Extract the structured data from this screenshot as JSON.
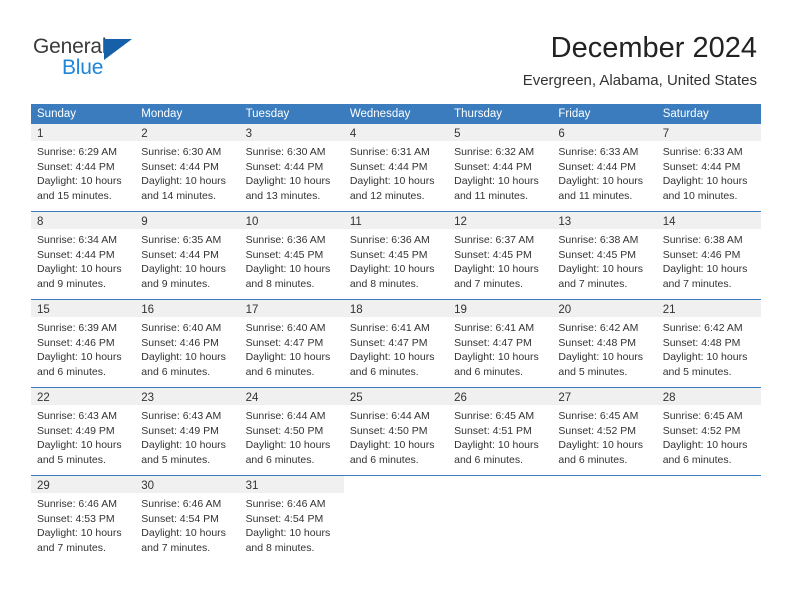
{
  "brand": {
    "name_part1": "General",
    "name_part2": "Blue",
    "accent_color": "#1f85d8",
    "triangle_color": "#1560a8",
    "logo_icon": "triangle-icon"
  },
  "header": {
    "title": "December 2024",
    "subtitle": "Evergreen, Alabama, United States"
  },
  "calendar": {
    "header_bg_color": "#3a7cbe",
    "daynum_bg_color": "#f0f0f0",
    "weekdays": [
      "Sunday",
      "Monday",
      "Tuesday",
      "Wednesday",
      "Thursday",
      "Friday",
      "Saturday"
    ],
    "weeks": [
      [
        {
          "day": "1",
          "sunrise": "Sunrise: 6:29 AM",
          "sunset": "Sunset: 4:44 PM",
          "daylight1": "Daylight: 10 hours",
          "daylight2": "and 15 minutes."
        },
        {
          "day": "2",
          "sunrise": "Sunrise: 6:30 AM",
          "sunset": "Sunset: 4:44 PM",
          "daylight1": "Daylight: 10 hours",
          "daylight2": "and 14 minutes."
        },
        {
          "day": "3",
          "sunrise": "Sunrise: 6:30 AM",
          "sunset": "Sunset: 4:44 PM",
          "daylight1": "Daylight: 10 hours",
          "daylight2": "and 13 minutes."
        },
        {
          "day": "4",
          "sunrise": "Sunrise: 6:31 AM",
          "sunset": "Sunset: 4:44 PM",
          "daylight1": "Daylight: 10 hours",
          "daylight2": "and 12 minutes."
        },
        {
          "day": "5",
          "sunrise": "Sunrise: 6:32 AM",
          "sunset": "Sunset: 4:44 PM",
          "daylight1": "Daylight: 10 hours",
          "daylight2": "and 11 minutes."
        },
        {
          "day": "6",
          "sunrise": "Sunrise: 6:33 AM",
          "sunset": "Sunset: 4:44 PM",
          "daylight1": "Daylight: 10 hours",
          "daylight2": "and 11 minutes."
        },
        {
          "day": "7",
          "sunrise": "Sunrise: 6:33 AM",
          "sunset": "Sunset: 4:44 PM",
          "daylight1": "Daylight: 10 hours",
          "daylight2": "and 10 minutes."
        }
      ],
      [
        {
          "day": "8",
          "sunrise": "Sunrise: 6:34 AM",
          "sunset": "Sunset: 4:44 PM",
          "daylight1": "Daylight: 10 hours",
          "daylight2": "and 9 minutes."
        },
        {
          "day": "9",
          "sunrise": "Sunrise: 6:35 AM",
          "sunset": "Sunset: 4:44 PM",
          "daylight1": "Daylight: 10 hours",
          "daylight2": "and 9 minutes."
        },
        {
          "day": "10",
          "sunrise": "Sunrise: 6:36 AM",
          "sunset": "Sunset: 4:45 PM",
          "daylight1": "Daylight: 10 hours",
          "daylight2": "and 8 minutes."
        },
        {
          "day": "11",
          "sunrise": "Sunrise: 6:36 AM",
          "sunset": "Sunset: 4:45 PM",
          "daylight1": "Daylight: 10 hours",
          "daylight2": "and 8 minutes."
        },
        {
          "day": "12",
          "sunrise": "Sunrise: 6:37 AM",
          "sunset": "Sunset: 4:45 PM",
          "daylight1": "Daylight: 10 hours",
          "daylight2": "and 7 minutes."
        },
        {
          "day": "13",
          "sunrise": "Sunrise: 6:38 AM",
          "sunset": "Sunset: 4:45 PM",
          "daylight1": "Daylight: 10 hours",
          "daylight2": "and 7 minutes."
        },
        {
          "day": "14",
          "sunrise": "Sunrise: 6:38 AM",
          "sunset": "Sunset: 4:46 PM",
          "daylight1": "Daylight: 10 hours",
          "daylight2": "and 7 minutes."
        }
      ],
      [
        {
          "day": "15",
          "sunrise": "Sunrise: 6:39 AM",
          "sunset": "Sunset: 4:46 PM",
          "daylight1": "Daylight: 10 hours",
          "daylight2": "and 6 minutes."
        },
        {
          "day": "16",
          "sunrise": "Sunrise: 6:40 AM",
          "sunset": "Sunset: 4:46 PM",
          "daylight1": "Daylight: 10 hours",
          "daylight2": "and 6 minutes."
        },
        {
          "day": "17",
          "sunrise": "Sunrise: 6:40 AM",
          "sunset": "Sunset: 4:47 PM",
          "daylight1": "Daylight: 10 hours",
          "daylight2": "and 6 minutes."
        },
        {
          "day": "18",
          "sunrise": "Sunrise: 6:41 AM",
          "sunset": "Sunset: 4:47 PM",
          "daylight1": "Daylight: 10 hours",
          "daylight2": "and 6 minutes."
        },
        {
          "day": "19",
          "sunrise": "Sunrise: 6:41 AM",
          "sunset": "Sunset: 4:47 PM",
          "daylight1": "Daylight: 10 hours",
          "daylight2": "and 6 minutes."
        },
        {
          "day": "20",
          "sunrise": "Sunrise: 6:42 AM",
          "sunset": "Sunset: 4:48 PM",
          "daylight1": "Daylight: 10 hours",
          "daylight2": "and 5 minutes."
        },
        {
          "day": "21",
          "sunrise": "Sunrise: 6:42 AM",
          "sunset": "Sunset: 4:48 PM",
          "daylight1": "Daylight: 10 hours",
          "daylight2": "and 5 minutes."
        }
      ],
      [
        {
          "day": "22",
          "sunrise": "Sunrise: 6:43 AM",
          "sunset": "Sunset: 4:49 PM",
          "daylight1": "Daylight: 10 hours",
          "daylight2": "and 5 minutes."
        },
        {
          "day": "23",
          "sunrise": "Sunrise: 6:43 AM",
          "sunset": "Sunset: 4:49 PM",
          "daylight1": "Daylight: 10 hours",
          "daylight2": "and 5 minutes."
        },
        {
          "day": "24",
          "sunrise": "Sunrise: 6:44 AM",
          "sunset": "Sunset: 4:50 PM",
          "daylight1": "Daylight: 10 hours",
          "daylight2": "and 6 minutes."
        },
        {
          "day": "25",
          "sunrise": "Sunrise: 6:44 AM",
          "sunset": "Sunset: 4:50 PM",
          "daylight1": "Daylight: 10 hours",
          "daylight2": "and 6 minutes."
        },
        {
          "day": "26",
          "sunrise": "Sunrise: 6:45 AM",
          "sunset": "Sunset: 4:51 PM",
          "daylight1": "Daylight: 10 hours",
          "daylight2": "and 6 minutes."
        },
        {
          "day": "27",
          "sunrise": "Sunrise: 6:45 AM",
          "sunset": "Sunset: 4:52 PM",
          "daylight1": "Daylight: 10 hours",
          "daylight2": "and 6 minutes."
        },
        {
          "day": "28",
          "sunrise": "Sunrise: 6:45 AM",
          "sunset": "Sunset: 4:52 PM",
          "daylight1": "Daylight: 10 hours",
          "daylight2": "and 6 minutes."
        }
      ],
      [
        {
          "day": "29",
          "sunrise": "Sunrise: 6:46 AM",
          "sunset": "Sunset: 4:53 PM",
          "daylight1": "Daylight: 10 hours",
          "daylight2": "and 7 minutes."
        },
        {
          "day": "30",
          "sunrise": "Sunrise: 6:46 AM",
          "sunset": "Sunset: 4:54 PM",
          "daylight1": "Daylight: 10 hours",
          "daylight2": "and 7 minutes."
        },
        {
          "day": "31",
          "sunrise": "Sunrise: 6:46 AM",
          "sunset": "Sunset: 4:54 PM",
          "daylight1": "Daylight: 10 hours",
          "daylight2": "and 8 minutes."
        },
        null,
        null,
        null,
        null
      ]
    ]
  }
}
